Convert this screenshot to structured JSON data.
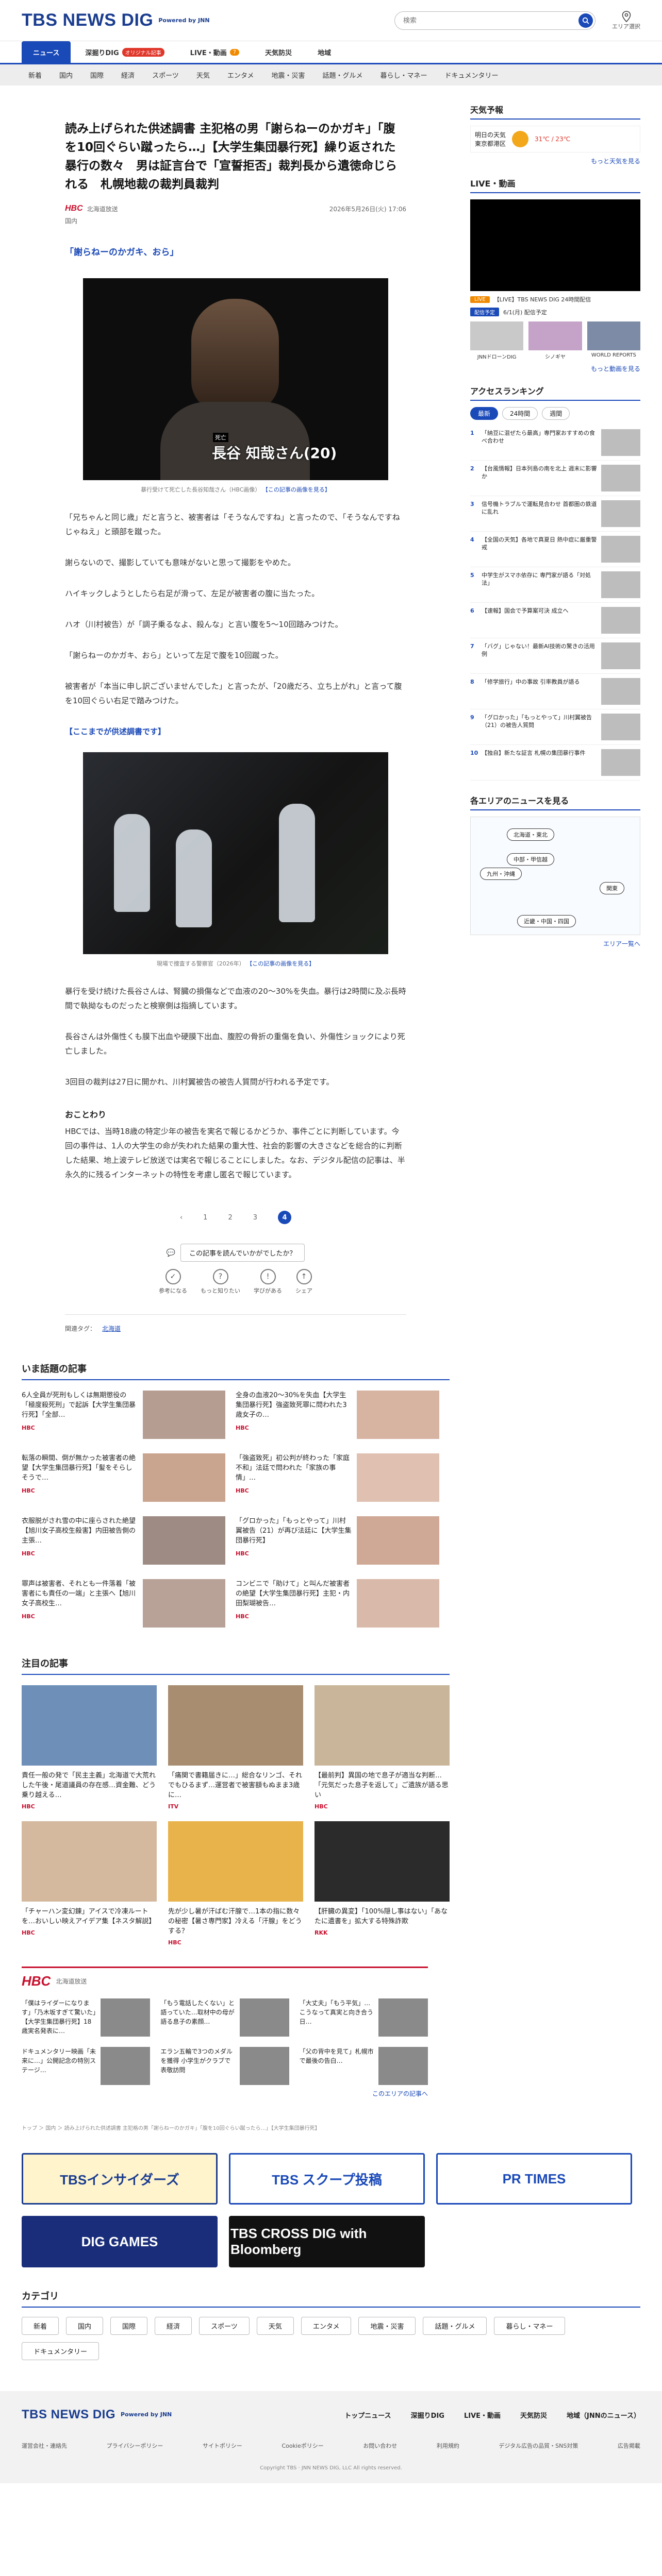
{
  "header": {
    "logo": "TBS NEWS DIG",
    "powered": "Powered by JNN",
    "search_placeholder": "検索",
    "area_label": "エリア選択"
  },
  "nav_primary": [
    {
      "label": "ニュース",
      "badge": ""
    },
    {
      "label": "深掘りDIG",
      "badge": "オリジナル記事"
    },
    {
      "label": "LIVE・動画",
      "badge": "7"
    },
    {
      "label": "天気防災",
      "badge": ""
    },
    {
      "label": "地域",
      "badge": ""
    }
  ],
  "nav_secondary": [
    "新着",
    "国内",
    "国際",
    "経済",
    "スポーツ",
    "天気",
    "エンタメ",
    "地震・災害",
    "話題・グルメ",
    "暮らし・マネー",
    "ドキュメンタリー"
  ],
  "article": {
    "title": "読み上げられた供述調書 主犯格の男「謝らねーのかガキ」「腹を10回ぐらい蹴ったら…」【大学生集団暴行死】繰り返された暴行の数々　男は証言台で「宣誓拒否」裁判長から遺徳命じられる　札幌地裁の裁判員裁判",
    "source_name": "北海道放送",
    "date": "2026年5月26日(火) 17:06",
    "genre": "国内",
    "subheading": "「謝らねーのかガキ、おら」",
    "photo1_name": "長谷 知哉さん(20)",
    "photo1_tag": "死亡",
    "photo1_caption": "暴行受けて死亡した長谷知哉さん（HBC画像）",
    "caption_link": "【この記事の画像を見る】",
    "paragraphs": [
      "「兄ちゃんと同じ歳」だと言うと、被害者は「そうなんですね」と言ったので、「そうなんですねじゃねえ」と頭部を蹴った。",
      "謝らないので、撮影していても意味がないと思って撮影をやめた。",
      "ハイキックしようとしたら右足が滑って、左足が被害者の腹に当たった。",
      "ハオ（川村被告）が「調子乗るなよ、殺んな」と言い腹を5〜10回踏みつけた。",
      "「謝らねーのかガキ、おら」といって左足で腹を10回蹴った。",
      "被害者が「本当に申し訳ございませんでした」と言ったが、「20歳だろ、立ち上がれ」と言って腹を10回ぐらい右足で踏みつけた。"
    ],
    "end_quote": "【ここまでが供述調書です】",
    "photo2_caption": "現場で捜査する警察官（2026年）",
    "paragraphs2": [
      "暴行を受け続けた長谷さんは、腎臓の損傷などで血液の20〜30%を失血。暴行は2時間に及ぶ長時間で執拗なものだったと検察側は指摘しています。",
      "長谷さんは外傷性くも膜下出血や硬膜下出血、腹腔の骨折の重傷を負い、外傷性ショックにより死亡しました。",
      "3回目の裁判は27日に開かれ、川村翼被告の被告人質問が行われる予定です。"
    ],
    "notice_title": "おことわり",
    "notice_text": "HBCでは、当時18歳の特定少年の被告を実名で報じるかどうか、事件ごとに判断しています。今回の事件は、1人の大学生の命が失われた結果の重大性、社会的影響の大きさなどを総合的に判断した結果、地上波テレビ放送では実名で報じることにしました。なお、デジタル配信の記事は、半永久的に残るインターネットの特性を考慮し匿名で報じています。",
    "pager": [
      "1",
      "2",
      "3",
      "4"
    ],
    "reaction_prompt": "この記事を読んでいかがでしたか？",
    "reactions": [
      "参考になる",
      "もっと知りたい",
      "学びがある",
      "シェア"
    ],
    "tag_label": "関連タグ：",
    "tag": "北海道"
  },
  "sidebar": {
    "weather_title": "天気予報",
    "weather_day": "明日の天気",
    "weather_place": "東京都港区",
    "weather_temp": "31℃ / 23℃",
    "weather_more": "もっと天気を見る",
    "live_title": "LIVE・動画",
    "live_items": [
      {
        "label": "LIVE",
        "text": "【LIVE】TBS NEWS DIG 24時間配信"
      },
      {
        "label": "配信予定",
        "text": "6/1(月) 配信予定"
      }
    ],
    "live_more": "もっと動画を見る",
    "originals": [
      "JNNドローンDIG",
      "シノギヤ",
      "WORLD REPORTS"
    ],
    "ranking_title": "アクセスランキング",
    "ranking_tabs": [
      "最新",
      "24時間",
      "週間"
    ],
    "ranking": [
      "「納豆に混ぜたら最高」専門家おすすめの食べ合わせ",
      "【台風情報】日本列島の南を北上 週末に影響か",
      "信号機トラブルで運転見合わせ 首都圏の鉄道に乱れ",
      "【全国の天気】各地で真夏日 熱中症に厳重警戒",
      "中学生がスマホ依存に 専門家が語る「対処法」",
      "【速報】国会で予算案可決 成立へ",
      "「バグ」じゃない！最新AI技術の驚きの活用例",
      "「修学旅行」中の事故 引率教員が語る",
      "「グロかった」「もっとやって」川村翼被告（21）の被告人質問",
      "【独自】新たな証言 札幌の集団暴行事件"
    ],
    "area_title": "各エリアのニュースを見る",
    "areas": [
      "北海道・東北",
      "中部・甲信越",
      "関東",
      "九州・沖縄",
      "近畿・中国・四国"
    ],
    "area_more": "エリア一覧へ"
  },
  "trending": {
    "title": "いま話題の記事",
    "items": [
      "6人全員が死刑もしくは無期懲役の「極度殺死刑」で起訴【大学生集団暴行死】「全部…",
      "全身の血液20〜30%を失血【大学生集団暴行死】強盗致死罪に問われた3歳女子の…",
      "転落の瞬間、倒が無かった被害者の絶望【大学生集団暴行死】「髪をそらしそうで…",
      "「強盗致死」初公判が終わった「家庭不和」法廷で問われた「家族の事情」…",
      "衣服脱がされ雪の中に座らされた絶望【旭川女子高校生殺害】内田被告側の主張…",
      "「グロかった」「もっとやって」川村翼被告（21）が再び法廷に【大学生集団暴行死】",
      "罪声は被害者、それとも一件落着「被害者にも責任の一端」と主張へ【旭川女子高校生…",
      "コンビニで「助けて」と叫んだ被害者の絶望【大学生集団暴行死】主犯・内田梨瑚被告…"
    ],
    "source": "HBC"
  },
  "featured": {
    "title": "注目の記事",
    "items": [
      {
        "text": "責任一般の発で「民主主義」北海道で大荒れした午後・尾道議員の存在感…資金難、どう乗り越える…",
        "src": "HBC"
      },
      {
        "text": "「痛関で書籍届きに…」総合なリンゴ、それでもひるまず…運営者で被害額もぬまま3歳に…",
        "src": "ITV"
      },
      {
        "text": "【最前判】異国の地で息子が適当な判断…「元気だった息子を返して」ご遺族が語る思い",
        "src": "HBC"
      },
      {
        "text": "「チャーハン変幻錬」アイスで冷凍ルートを…おいしい映えアイデア集【ネスタ解説】",
        "src": "HBC"
      },
      {
        "text": "先が少し暑が汗ばむ汗腺で…1本の指に数々の秘密【暑さ専門家】冷える「汗腺」をどうする？",
        "src": "HBC"
      },
      {
        "text": "【肝臓の異変】「100%隠し事はない」「あなたに遺書を」拡大する特殊詐欺",
        "src": "RKK"
      }
    ]
  },
  "hbc_section": {
    "title": "北海道放送",
    "items": [
      "「僕はライダーになります」「乃木坂すぎて驚いた」【大学生集団暴行死】18歳実名発表に…",
      "「もう電話したくない」と語っていた…取材中の母が語る息子の素顔…",
      "「大丈夫」「もう平気」…こうなって真実と向き合う日…",
      "ドキュメンタリー映画「未来に…」公開記念の特別ステージ…",
      "エラン五輪で3つのメダルを獲得 小学生がクラブで表敬訪問",
      "「父の背中を見て」札幌市で最後の告白…"
    ],
    "more": "このエリアの記事へ"
  },
  "breadcrumb": "トップ ＞ 国内 ＞ 読み上げられた供述調書 主犯格の男「謝らねーのかガキ」「腹を10回ぐらい蹴ったら…」【大学生集団暴行死】",
  "banners": [
    {
      "label": "TBSインサイダーズ",
      "bg": "#fff4cc",
      "fg": "#1a3d8f"
    },
    {
      "label": "TBS スクープ投稿",
      "bg": "#ffffff",
      "fg": "#1a49b8"
    },
    {
      "label": "PR TIMES",
      "bg": "#ffffff",
      "fg": "#1a49b8"
    },
    {
      "label": "DIG GAMES",
      "bg": "#1a2d7a",
      "fg": "#ffffff"
    },
    {
      "label": "TBS CROSS DIG with Bloomberg",
      "bg": "#111111",
      "fg": "#ffffff"
    }
  ],
  "categories": {
    "title": "カテゴリ",
    "items": [
      "新着",
      "国内",
      "国際",
      "経済",
      "スポーツ",
      "天気",
      "エンタメ",
      "地震・災害",
      "話題・グルメ",
      "暮らし・マネー",
      "ドキュメンタリー"
    ]
  },
  "footer": {
    "links": [
      "トップニュース",
      "深掘りDIG",
      "LIVE・動画",
      "天気防災",
      "地域（JNNのニュース）"
    ],
    "sub": [
      "運営会社・連絡先",
      "プライバシーポリシー",
      "サイトポリシー",
      "Cookieポリシー",
      "お問い合わせ",
      "利用規約",
      "デジタル広告の品質・SNS対策",
      "広告掲載"
    ],
    "copyright": "Copyright TBS · JNN NEWS DIG, LLC All rights reserved."
  },
  "colors": {
    "accent": "#1a49b8",
    "hbc": "#c8102e",
    "badge": "#e0372b"
  }
}
